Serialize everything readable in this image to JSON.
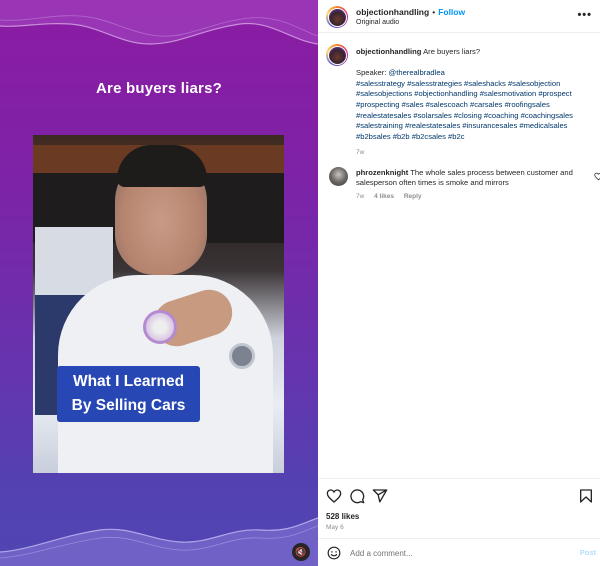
{
  "media": {
    "title_text": "Are buyers liars?",
    "video_caption_line1": "What I Learned",
    "video_caption_line2": "By Selling Cars",
    "mute_icon": "speaker-muted-icon"
  },
  "header": {
    "username": "objectionhandling",
    "separator": "•",
    "follow_label": "Follow",
    "audio_label": "Original audio",
    "more_label": "•••"
  },
  "caption": {
    "username": "objectionhandling",
    "text": "Are buyers liars?",
    "speaker_label": "Speaker:",
    "speaker_mention": "@therealbradlea",
    "hashtag_lines": [
      "#salesstrategy #salesstrategies #saleshacks #salesobjection",
      "#salesobjections #objectionhandling #salesmotivation #prospect",
      "#prospecting #sales #salescoach #carsales #roofingsales",
      "#realestatesales #solarsales #closing #coaching #coachingsales",
      "#salestraining #realestatesales #insurancesales #medicalsales",
      "#b2bsales #b2b #b2csales #b2c"
    ],
    "time": "7w"
  },
  "comments": [
    {
      "username": "phrozenknight",
      "text": "The whole sales process between customer and salesperson often times is smoke and mirrors",
      "time": "7w",
      "likes": "4 likes",
      "reply_label": "Reply"
    }
  ],
  "actions": {
    "like_icon": "heart-icon",
    "comment_icon": "comment-icon",
    "share_icon": "share-icon",
    "save_icon": "bookmark-icon",
    "likes_count": "528 likes",
    "date": "May 6"
  },
  "add_comment": {
    "placeholder": "Add a comment...",
    "value": "",
    "post_label": "Post"
  },
  "colors": {
    "accent": "#0095f6",
    "hashtag": "#00376b",
    "muted": "#8e8e8e",
    "post_disabled": "#b2dffc",
    "media_gradient_top": "#8b1ca3",
    "media_gradient_bottom": "#5046b3",
    "video_caption_bg": "#2747b4"
  }
}
